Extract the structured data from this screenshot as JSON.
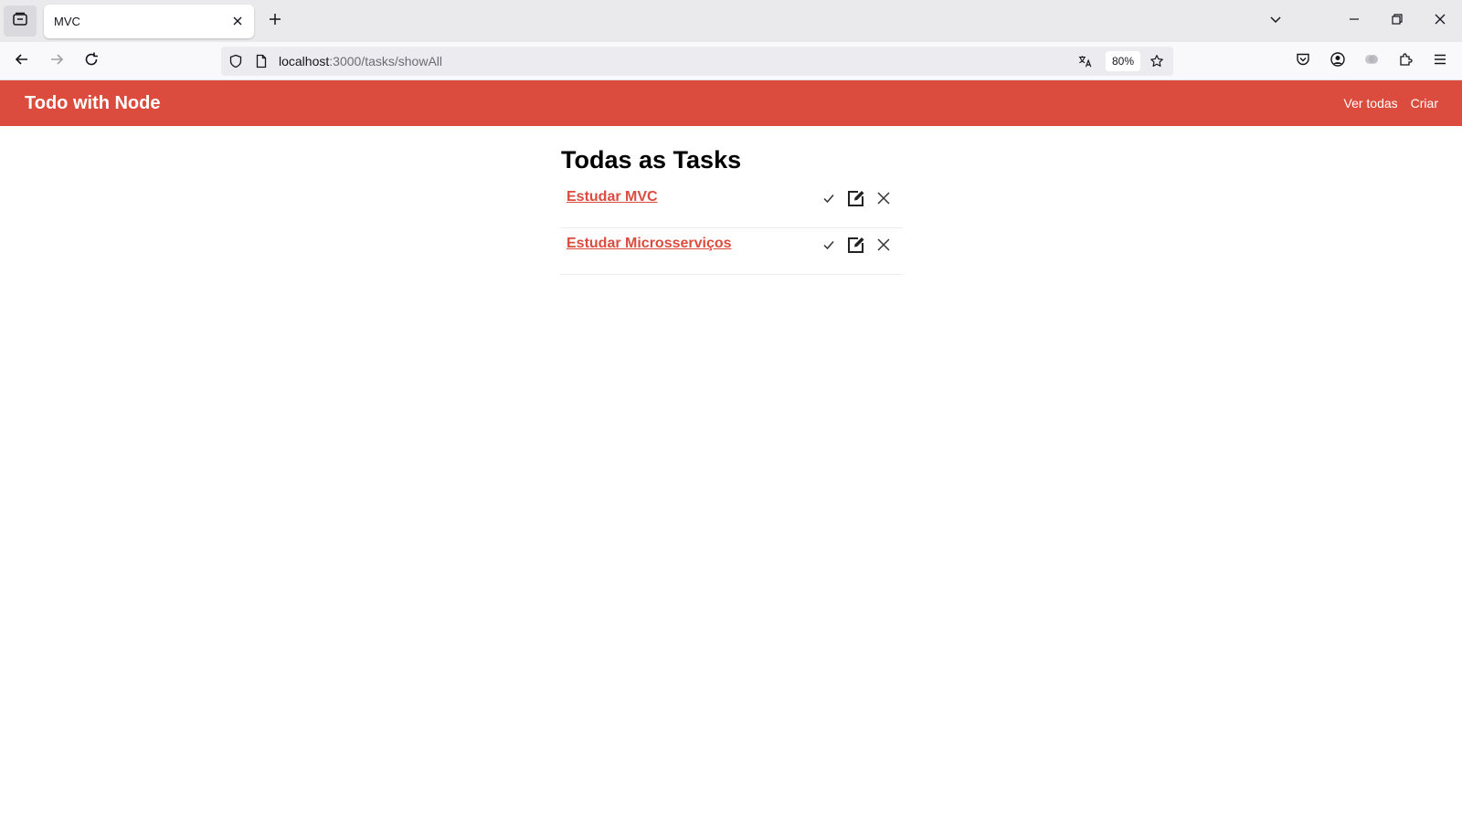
{
  "browser": {
    "tab": {
      "title": "MVC"
    },
    "url": {
      "host": "localhost",
      "path": ":3000/tasks/showAll"
    },
    "zoom": "80%"
  },
  "app": {
    "brand": "Todo with Node",
    "nav": [
      {
        "label": "Ver todas"
      },
      {
        "label": "Criar"
      }
    ],
    "heading": "Todas as Tasks",
    "tasks": [
      {
        "title": "Estudar MVC"
      },
      {
        "title": "Estudar Microsserviços"
      }
    ]
  },
  "colors": {
    "accent": "#dc4c3e",
    "header_text": "#ffffff",
    "chrome_bg": "#eaeaed"
  },
  "icons": [
    "tab-list-icon",
    "close-icon",
    "plus-icon",
    "chevron-down-icon",
    "minimize-icon",
    "restore-icon",
    "back-icon",
    "forward-icon",
    "reload-icon",
    "shield-icon",
    "page-icon",
    "translate-icon",
    "star-icon",
    "pocket-icon",
    "account-icon",
    "extension-icon",
    "puzzle-icon",
    "menu-icon",
    "check-icon",
    "edit-icon",
    "delete-icon"
  ]
}
